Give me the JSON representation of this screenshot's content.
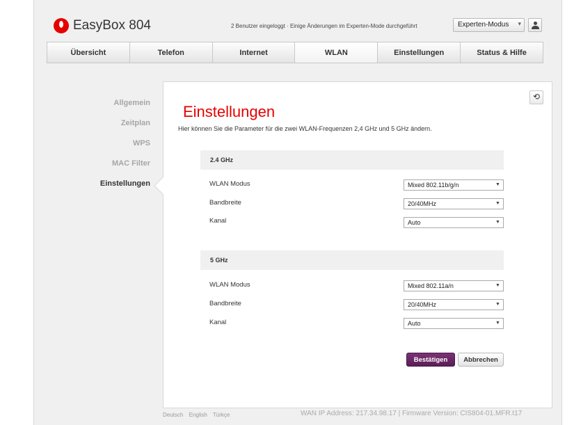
{
  "header": {
    "app_title": "EasyBox 804",
    "status_message": "2 Benutzer eingeloggt · Einige Änderungen im Experten-Mode durchgeführt",
    "mode_select": "Experten-Modus",
    "brand_color": "#e60000"
  },
  "topnav": [
    {
      "label": "Übersicht"
    },
    {
      "label": "Telefon"
    },
    {
      "label": "Internet"
    },
    {
      "label": "WLAN",
      "active": true
    },
    {
      "label": "Einstellungen"
    },
    {
      "label": "Status & Hilfe"
    }
  ],
  "sidebar": [
    {
      "label": "Allgemein"
    },
    {
      "label": "Zeitplan"
    },
    {
      "label": "WPS"
    },
    {
      "label": "MAC Filter"
    },
    {
      "label": "Einstellungen",
      "active": true
    }
  ],
  "main": {
    "title": "Einstellungen",
    "description": "Hier können Sie die Parameter für die zwei WLAN-Frequenzen 2,4 GHz und 5 GHz ändern.",
    "sections": [
      {
        "heading": "2.4 GHz",
        "rows": [
          {
            "label": "WLAN Modus",
            "value": "Mixed 802.11b/g/n"
          },
          {
            "label": "Bandbreite",
            "value": "20/40MHz"
          },
          {
            "label": "Kanal",
            "value": "Auto"
          }
        ]
      },
      {
        "heading": "5 GHz",
        "rows": [
          {
            "label": "WLAN Modus",
            "value": "Mixed 802.11a/n"
          },
          {
            "label": "Bandbreite",
            "value": "20/40MHz"
          },
          {
            "label": "Kanal",
            "value": "Auto"
          }
        ]
      }
    ],
    "confirm_label": "Bestätigen",
    "cancel_label": "Abbrechen",
    "confirm_color": "#6b2a67"
  },
  "footer": {
    "languages": [
      "Deutsch",
      "English",
      "Türkçe"
    ],
    "info": "WAN IP Address: 217.34.98.17 | Firmware Version: CIS804-01.MFR.t17"
  }
}
